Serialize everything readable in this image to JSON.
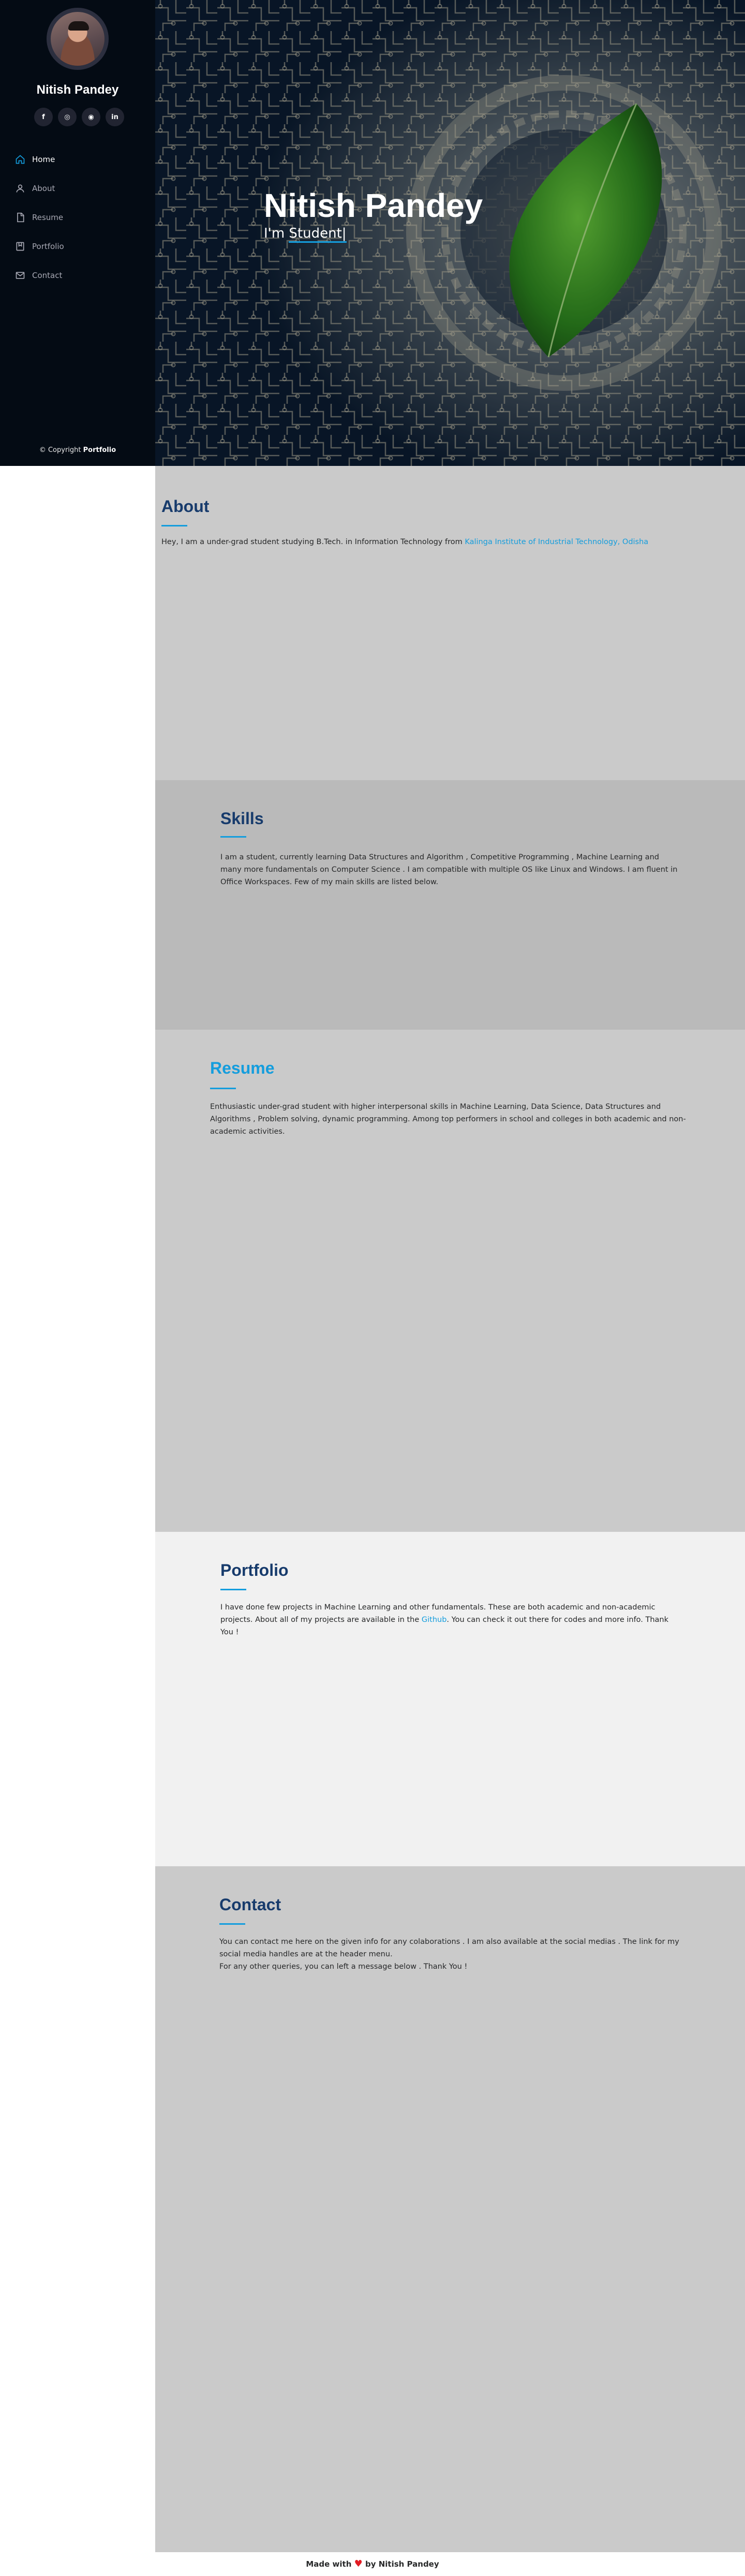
{
  "profile": {
    "name": "Nitish Pandey"
  },
  "socials": [
    {
      "label": "f",
      "icon": "facebook-icon"
    },
    {
      "label": "◎",
      "icon": "instagram-icon"
    },
    {
      "label": "◉",
      "icon": "github-icon"
    },
    {
      "label": "in",
      "icon": "linkedin-icon"
    }
  ],
  "nav": [
    {
      "label": "Home",
      "icon": "home-icon",
      "active": true
    },
    {
      "label": "About",
      "icon": "user-icon"
    },
    {
      "label": "Resume",
      "icon": "file-icon"
    },
    {
      "label": "Portfolio",
      "icon": "book-icon"
    },
    {
      "label": "Contact",
      "icon": "mail-icon"
    }
  ],
  "copyright": {
    "prefix": "© Copyright ",
    "brand": "Portfolio"
  },
  "hero": {
    "title": "Nitish Pandey",
    "subtitle_prefix": "I'm ",
    "subtitle_typed": "Student|"
  },
  "about": {
    "title": "About",
    "text": "Hey, I am a under-grad student studying B.Tech. in Information Technology from ",
    "link": "Kalinga Institute of Industrial Technology, Odisha"
  },
  "skills": {
    "title": "Skills",
    "text": "I am a student, currently learning Data Structures and Algorithm , Competitive Programming , Machine Learning and many more fundamentals on Computer Science . I am compatible with multiple OS like Linux and Windows. I am fluent in Office Workspaces. Few of my main skills are listed below."
  },
  "resume": {
    "title": "Resume",
    "text": "Enthusiastic under-grad student with higher interpersonal skills in Machine Learning, Data Science, Data Structures and Algorithms , Problem solving, dynamic programming. Among top performers in school and colleges in both academic and non-academic activities."
  },
  "portfolio": {
    "title": "Portfolio",
    "text_before": "I have done few projects in Machine Learning and other fundamentals. These are both academic and non-academic projects. About all of my projects are available in the ",
    "link": "Github",
    "text_after": ". You can check it out there for codes and more info. Thank You !"
  },
  "contact": {
    "title": "Contact",
    "text1": "You can contact me here on the given info for any colaborations . I am also available at the social medias . The link for my social media handles are at the header menu.",
    "text2": "For any other queries, you can left a message below . Thank You !"
  },
  "footer": {
    "prefix": "Made with ",
    "heart": "♥",
    "suffix": " by Nitish Pandey"
  },
  "colors": {
    "accent": "#149ddd",
    "title": "#173b6c",
    "sidebar": "#040b14"
  }
}
